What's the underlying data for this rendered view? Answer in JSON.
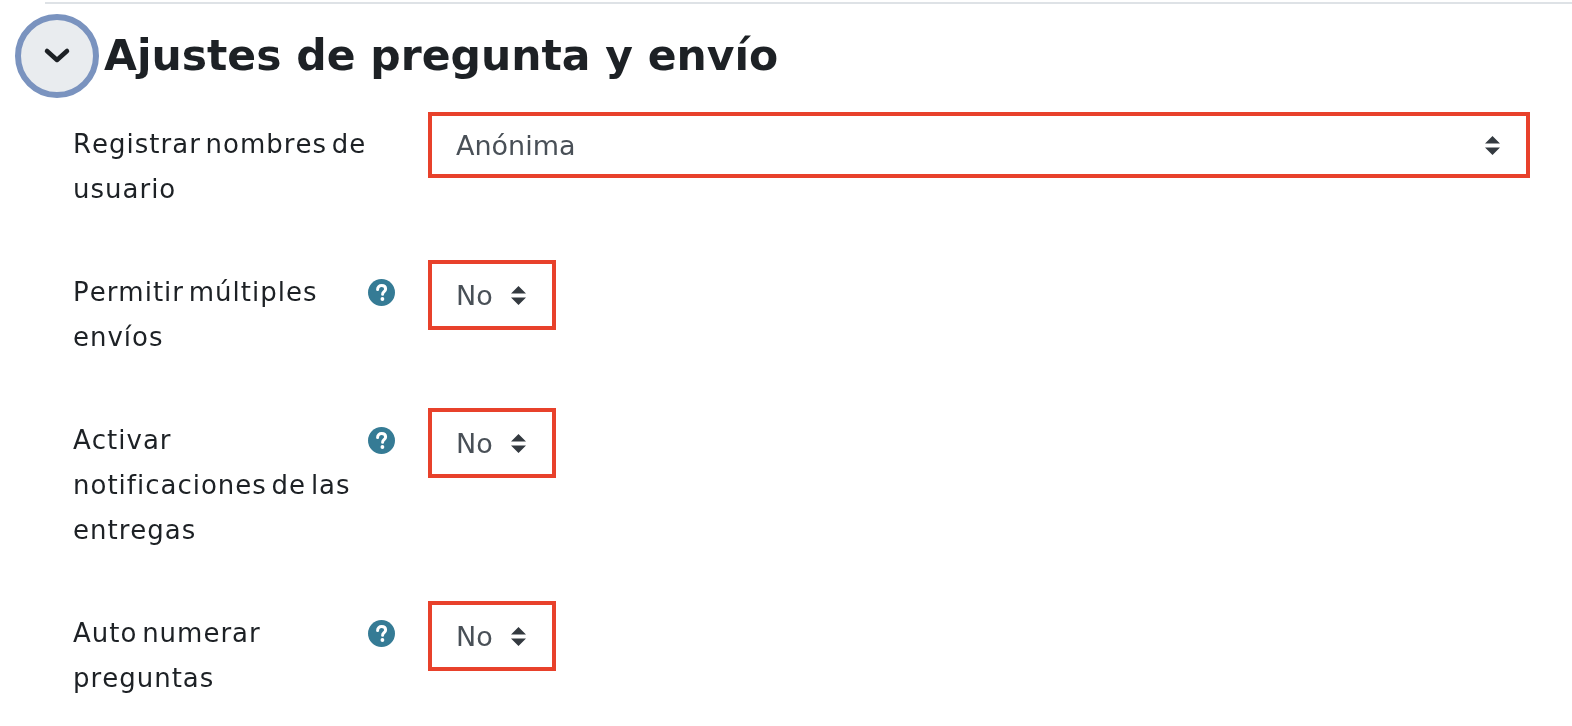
{
  "section": {
    "title": "Ajustes de pregunta y envío",
    "expanded": true
  },
  "fields": [
    {
      "label": "Registrar nombres de usuario",
      "help": false,
      "kind": "wide",
      "value": "Anónima",
      "highlighted": true
    },
    {
      "label": "Permitir múltiples envíos",
      "help": true,
      "kind": "compact",
      "value": "No",
      "highlighted": true
    },
    {
      "label": "Activar notificaciones de las entregas",
      "help": true,
      "kind": "compact",
      "value": "No",
      "highlighted": true
    },
    {
      "label": "Auto numerar preguntas",
      "help": true,
      "kind": "compact",
      "value": "No",
      "highlighted": true
    }
  ]
}
